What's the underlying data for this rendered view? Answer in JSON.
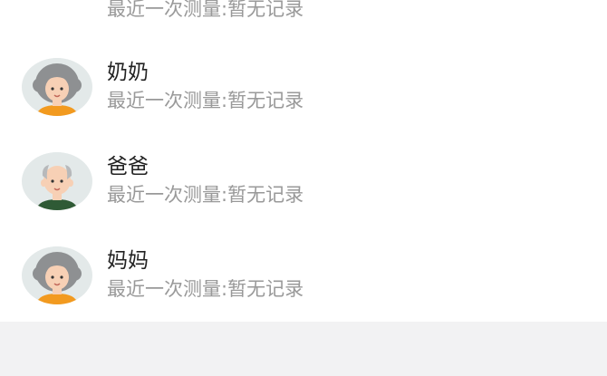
{
  "members": [
    {
      "name": "",
      "status": "最近一次测量:暂无记录",
      "avatar": "grandpa-avatar-icon"
    },
    {
      "name": "奶奶",
      "status": "最近一次测量:暂无记录",
      "avatar": "grandma-avatar-icon"
    },
    {
      "name": "爸爸",
      "status": "最近一次测量:暂无记录",
      "avatar": "dad-avatar-icon"
    },
    {
      "name": "妈妈",
      "status": "最近一次测量:暂无记录",
      "avatar": "mom-avatar-icon"
    }
  ],
  "colors": {
    "background": "#f2f2f3",
    "card": "#ffffff",
    "name_text": "#222222",
    "status_text": "#999999",
    "avatar_bg": "#e3e9e9",
    "gray_hair": "#8e9092",
    "skin": "#f7d0b5",
    "green_shirt": "#2f5a35",
    "orange_shirt": "#f29a1f"
  }
}
